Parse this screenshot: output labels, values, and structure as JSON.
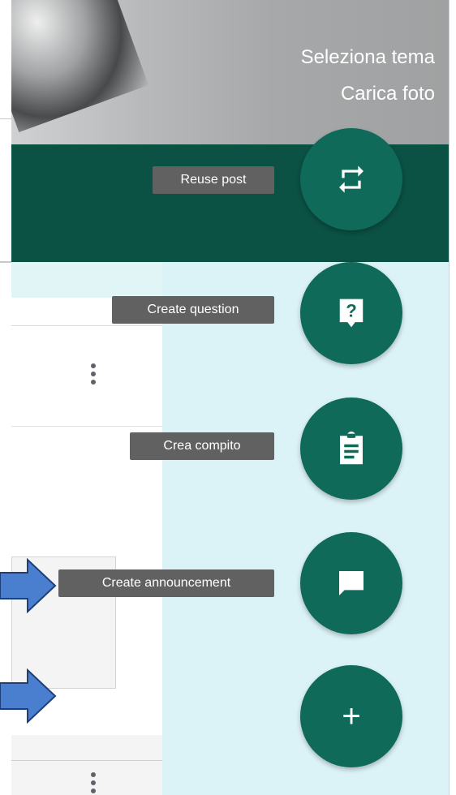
{
  "header": {
    "theme_link": "Seleziona tema",
    "upload_link": "Carica foto"
  },
  "speed_dial": {
    "actions": [
      {
        "tooltip": "Reuse post",
        "icon": "repeat-icon"
      },
      {
        "tooltip": "Create question",
        "icon": "question-icon"
      },
      {
        "tooltip": "Crea compito",
        "icon": "assignment-icon"
      },
      {
        "tooltip": "Create announcement",
        "icon": "chat-icon"
      }
    ],
    "main_button_icon": "plus-icon",
    "main_button_glyph": "+"
  },
  "colors": {
    "primary": "#0f6a5a",
    "band": "#0b5144",
    "panel": "#e1f5f7",
    "tooltip": "#616161",
    "annotation_arrow": "#4a7fd0"
  }
}
